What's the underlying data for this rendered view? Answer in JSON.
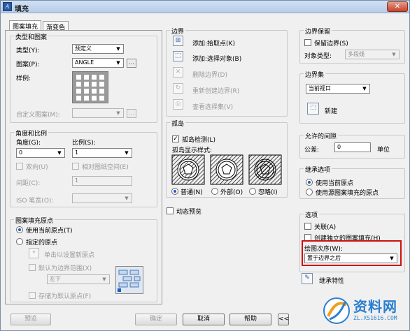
{
  "window": {
    "title": "填充",
    "close_glyph": "✕"
  },
  "tabs": [
    {
      "label": "图案填充"
    },
    {
      "label": "渐变色"
    }
  ],
  "type_pattern": {
    "group_label": "类型和图案",
    "type_label": "类型(Y):",
    "type_value": "预定义",
    "pattern_label": "图案(P):",
    "pattern_value": "ANGLE",
    "swatch_label": "样例:",
    "custom_label": "自定义图案(M):",
    "custom_value": ""
  },
  "angle_scale": {
    "group_label": "角度和比例",
    "angle_label": "角度(G):",
    "angle_value": "0",
    "scale_label": "比例(S):",
    "scale_value": "1",
    "double_label": "双向(U)",
    "relative_label": "相对图纸空间(E)",
    "spacing_label": "间距(C):",
    "spacing_value": "1",
    "iso_label": "ISO 笔宽(O):",
    "iso_value": ""
  },
  "origin": {
    "group_label": "图案填充原点",
    "current_label": "使用当前原点(T)",
    "specified_label": "指定的原点",
    "click_label": "单击以设置新原点",
    "default_extent_label": "默认为边界范围(X)",
    "extent_value": "左下",
    "store_label": "存储为默认原点(F)"
  },
  "boundary": {
    "group_label": "边界",
    "add_pick_label": "添加:拾取点(K)",
    "add_select_label": "添加:选择对象(B)",
    "remove_label": "删除边界(D)",
    "recreate_label": "重新创建边界(R)",
    "view_label": "查看选择集(V)"
  },
  "islands": {
    "group_label": "孤岛",
    "detect_label": "孤岛检测(L)",
    "style_label": "孤岛显示样式:",
    "normal_label": "普通(N)",
    "outer_label": "外部(O)",
    "ignore_label": "忽略(I)"
  },
  "preview_check_label": "动态预览",
  "boundary_retention": {
    "group_label": "边界保留",
    "retain_label": "保留边界(S)",
    "object_type_label": "对象类型:",
    "object_type_value": "多段线"
  },
  "boundary_set": {
    "group_label": "边界集",
    "value": "当前视口",
    "new_label": "新建"
  },
  "gap": {
    "group_label": "允许的间隙",
    "tolerance_label": "公差:",
    "tolerance_value": "0",
    "unit_label": "单位"
  },
  "inherit": {
    "group_label": "继承选项",
    "current_origin_label": "使用当前原点",
    "source_origin_label": "使用源图案填充的原点"
  },
  "options": {
    "group_label": "选项",
    "assoc_label": "关联(A)",
    "separate_label": "创建独立的图案填充(H)",
    "draw_order_label": "绘图次序(W):",
    "draw_order_value": "置于边界之后",
    "inherit_props_label": "继承特性"
  },
  "footer": {
    "preview_label": "预览",
    "ok_label": "确定",
    "cancel_label": "取消",
    "help_label": "帮助",
    "collapse_label": "<<"
  },
  "watermark": {
    "main_text": "资料网",
    "url_text": "ZL.XS1616.COM"
  },
  "colors": {
    "accent": "#1e5bc6",
    "highlight": "#d01010",
    "watermark": "#2a7fd0"
  }
}
